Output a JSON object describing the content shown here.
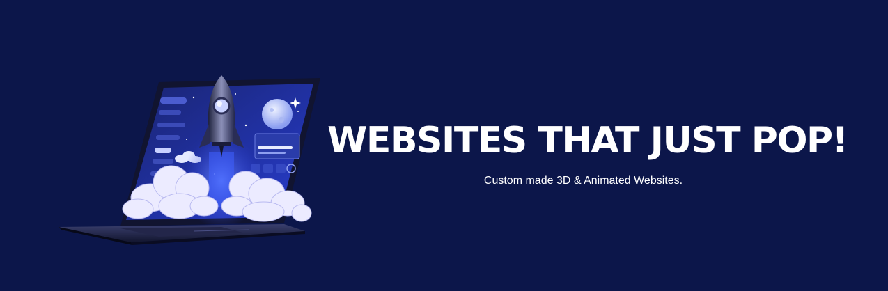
{
  "banner": {
    "headline": "WEBSITES THAT JUST POP!",
    "tagline": "Custom made 3D & Animated Websites."
  },
  "illustration": {
    "subject": "laptop-with-rocket-launch",
    "icons": [
      "laptop-icon",
      "rocket-icon",
      "planet-icon",
      "cloud-icon",
      "star-icon"
    ]
  },
  "colors": {
    "background": "#0c164a",
    "text": "#ffffff",
    "screen": "#1b2aa0",
    "glow": "#3a5cff"
  }
}
